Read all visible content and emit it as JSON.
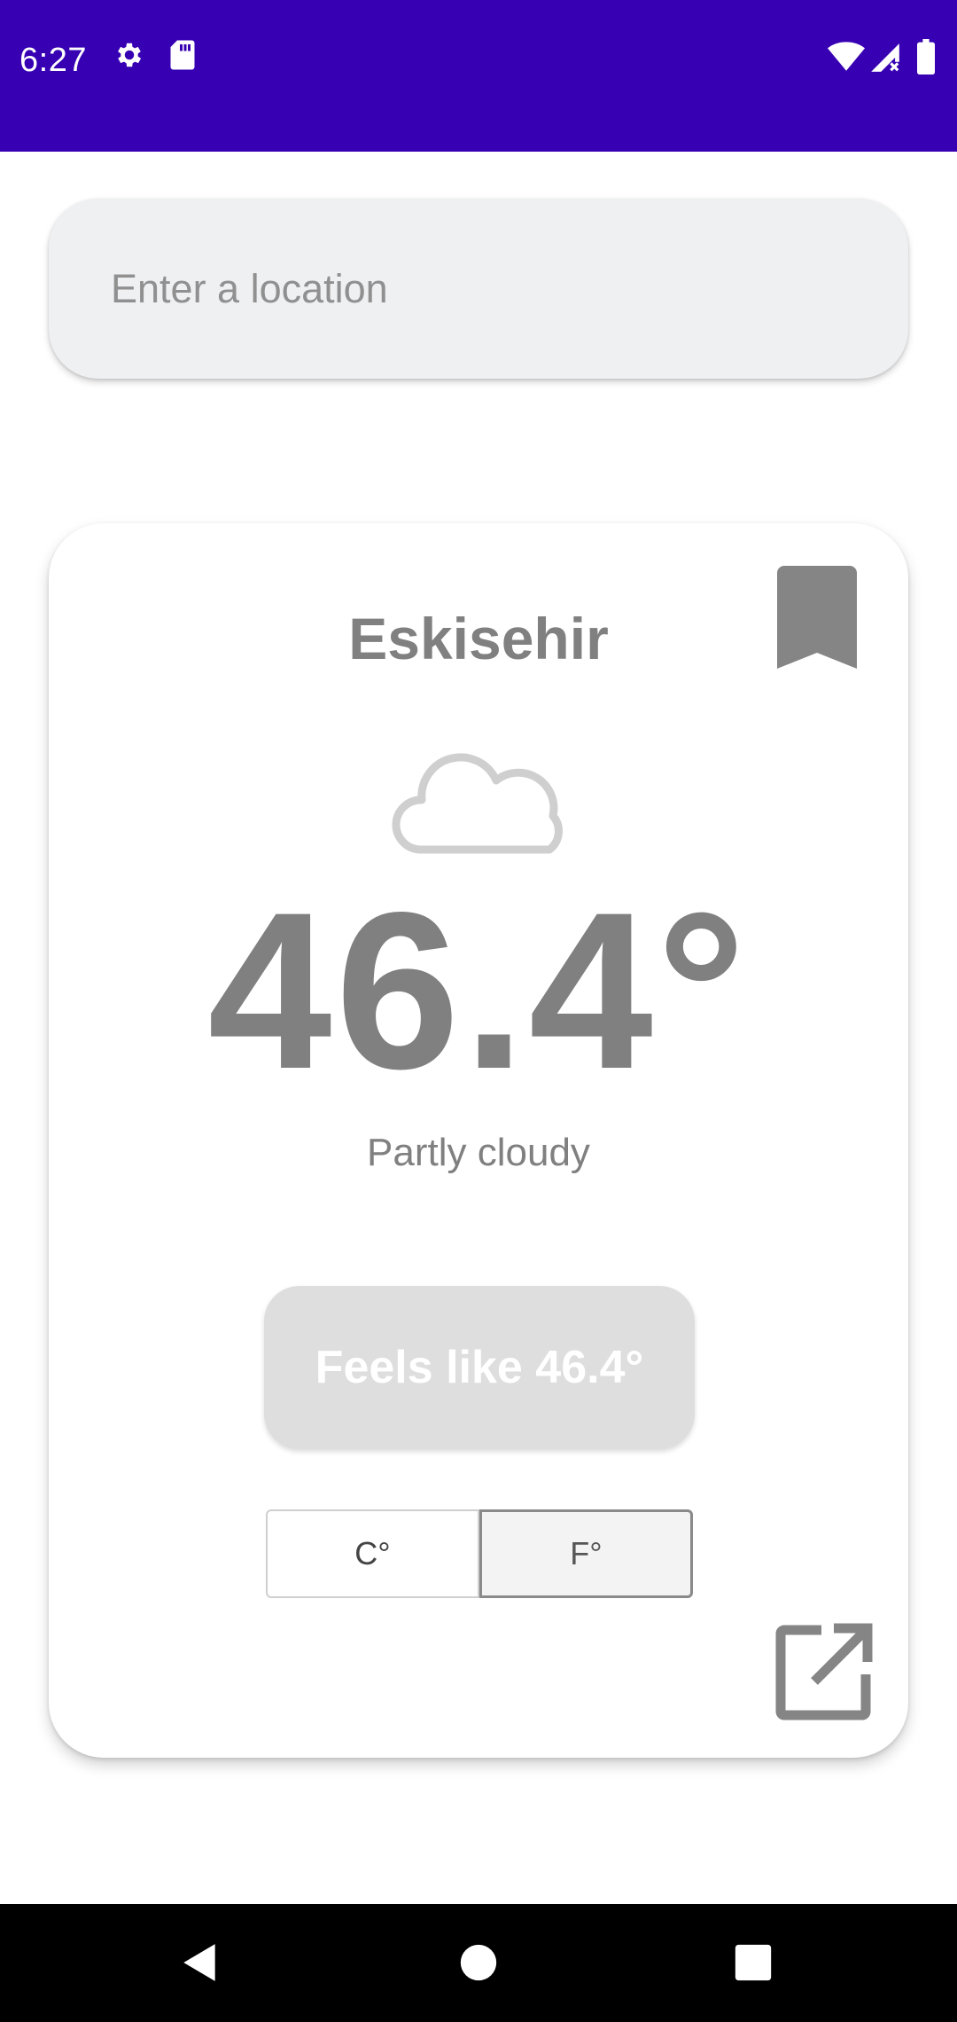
{
  "status_bar": {
    "time": "6:27",
    "background": "#3700b3",
    "icons": [
      "gear-icon",
      "sd-card-icon",
      "wifi-icon",
      "signal-icon",
      "battery-icon"
    ]
  },
  "search": {
    "placeholder": "Enter a location",
    "value": ""
  },
  "weather": {
    "city": "Eskisehir",
    "icon": "partly-cloudy-night-icon",
    "temperature": "46.4°",
    "condition": "Partly cloudy",
    "feels_like": "Feels like 46.4°",
    "bookmark_icon": "bookmark-icon",
    "open_icon": "open-external-icon"
  },
  "units": {
    "celsius_label": "C°",
    "fahrenheit_label": "F°",
    "selected": "F°"
  },
  "nav": {
    "back_icon": "back-icon",
    "home_icon": "home-icon",
    "recents_icon": "recents-icon"
  },
  "colors": {
    "accent": "#3700b3",
    "text_gray": "#808080",
    "moon_blue": "#0a74d6"
  }
}
